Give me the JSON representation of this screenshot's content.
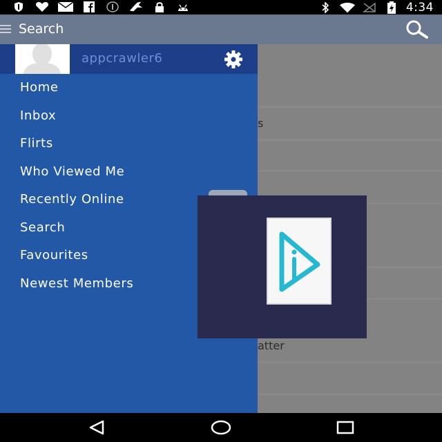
{
  "status_bar": {
    "time": "4:34",
    "left_icons": [
      "shield-icon",
      "heart-icon",
      "mail-icon",
      "facebook-icon",
      "info-icon",
      "bird-icon",
      "lock-icon",
      "android-icon"
    ],
    "right_icons": [
      "bluetooth-icon",
      "wifi-icon",
      "no-sim-icon",
      "battery-icon"
    ]
  },
  "app_bar": {
    "title": "Search",
    "menu_icon": "hamburger-icon",
    "action_icon": "search-icon"
  },
  "drawer": {
    "username": "appcrawler6",
    "settings_icon": "gear-icon",
    "items": [
      {
        "label": "Home"
      },
      {
        "label": "Inbox"
      },
      {
        "label": "Flirts"
      },
      {
        "label": "Who Viewed Me"
      },
      {
        "label": "Recently Online"
      },
      {
        "label": "Search"
      },
      {
        "label": "Favourites"
      },
      {
        "label": "Newest Members"
      }
    ]
  },
  "background_content": {
    "fragments": [
      {
        "text": "s"
      },
      {
        "text": "atter"
      }
    ]
  },
  "nav_bar": {
    "buttons": [
      "back-icon",
      "home-icon",
      "recents-icon"
    ]
  },
  "colors": {
    "drawer_bg": "#2358a6",
    "drawer_header_bg": "#1d3f89",
    "app_bar_bg": "#6a7990",
    "username_color": "#6f8fd3",
    "overlay_bg": "#2a2a4e",
    "logo_accent": "#25b8d0"
  }
}
